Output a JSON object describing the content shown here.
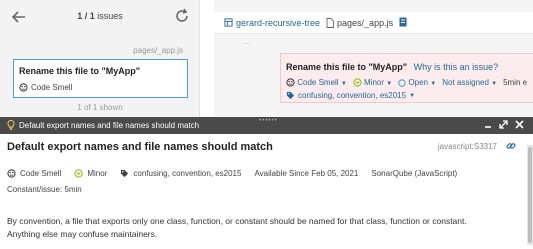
{
  "issues_panel": {
    "count_label": "1 / 1",
    "count_suffix": "issues",
    "file_path": "pages/_app.js",
    "card": {
      "title": "Rename this file to \"MyApp\"",
      "type": "Code Smell"
    },
    "shown_label": "1 of 1 shown"
  },
  "code_pane": {
    "breadcrumb": {
      "project": "gerard-recursive-tree",
      "file": "pages/_app.js"
    },
    "gutter": "…",
    "issue": {
      "title": "Rename this file to \"MyApp\"",
      "why_link": "Why is this an issue?",
      "type": "Code Smell",
      "severity": "Minor",
      "status": "Open",
      "assignee": "Not assigned",
      "effort": "5min e",
      "tags": "confusing, convention, es2015"
    }
  },
  "rule_panel": {
    "bar_title": "Default export names and file names should match",
    "title": "Default export names and file names should match",
    "rule_key": "javascript:S3317",
    "meta": {
      "type": "Code Smell",
      "severity": "Minor",
      "tags": "confusing, convention, es2015",
      "available_since": "Available Since Feb 05, 2021",
      "engine": "SonarQube (JavaScript)"
    },
    "effort": "Constant/issue: 5min",
    "description": "By convention, a file that exports only one class, function, or constant should be named for that class, function or constant. Anything else may confuse maintainers."
  },
  "colors": {
    "link": "#236a97",
    "selected_border": "#4b9fd5",
    "issue_bg": "#fcecee",
    "bar_bg": "#4a4a4a",
    "minor": "#8fc41a",
    "open": "#4b9fd5"
  },
  "icons": {
    "back": "arrow-left-icon",
    "refresh": "refresh-icon",
    "code_smell": "code-smell-icon",
    "minor": "minor-severity-icon",
    "status": "open-status-icon",
    "tags": "tag-icon",
    "project": "project-icon",
    "file": "file-icon",
    "copy": "copy-icon",
    "bulb": "lightbulb-icon",
    "link": "link-icon"
  }
}
